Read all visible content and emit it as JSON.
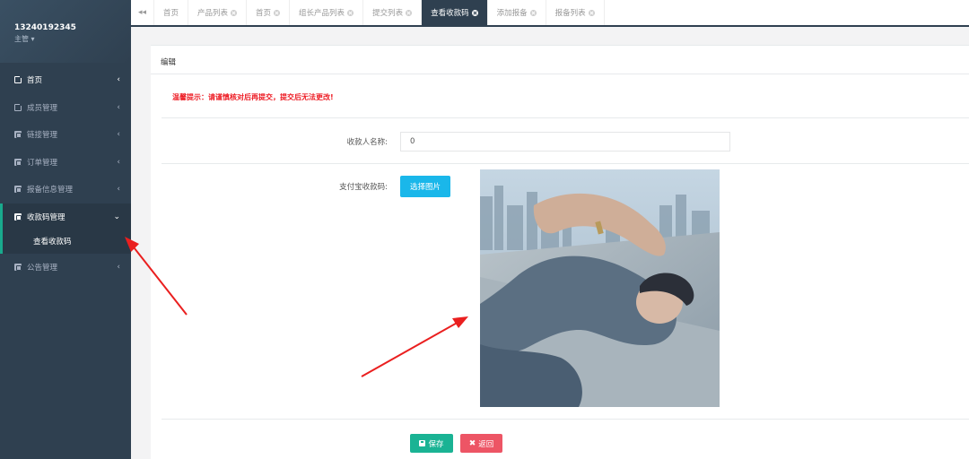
{
  "user": {
    "phone": "13240192345",
    "role": "主管 ▾"
  },
  "sidebar": {
    "items": [
      {
        "label": "首页"
      },
      {
        "label": "成员管理"
      },
      {
        "label": "链接管理"
      },
      {
        "label": "订单管理"
      },
      {
        "label": "报备信息管理"
      },
      {
        "label": "收款码管理"
      },
      {
        "label": "公告管理"
      }
    ],
    "sub_active": "查看收款码"
  },
  "tabs": {
    "back": "◂◂",
    "items": [
      {
        "label": "首页"
      },
      {
        "label": "产品列表"
      },
      {
        "label": "首页"
      },
      {
        "label": "组长产品列表"
      },
      {
        "label": "提交列表"
      },
      {
        "label": "查看收款码"
      },
      {
        "label": "添加报备"
      },
      {
        "label": "报备列表"
      }
    ]
  },
  "panel": {
    "title": "编辑",
    "warning": "温馨提示：请谨慎核对后再提交，提交后无法更改!",
    "fields": {
      "payee_label": "收款人名称:",
      "payee_value": "0",
      "alipay_label": "支付宝收款码:",
      "choose_button": "选择图片"
    },
    "buttons": {
      "save": "保存",
      "back": "返回"
    }
  },
  "colors": {
    "sidebar": "#2f4050",
    "accent": "#19aa8d",
    "warning": "#ed1c24",
    "primary": "#1ab394",
    "danger": "#ed5565",
    "info": "#1ab7ea"
  }
}
